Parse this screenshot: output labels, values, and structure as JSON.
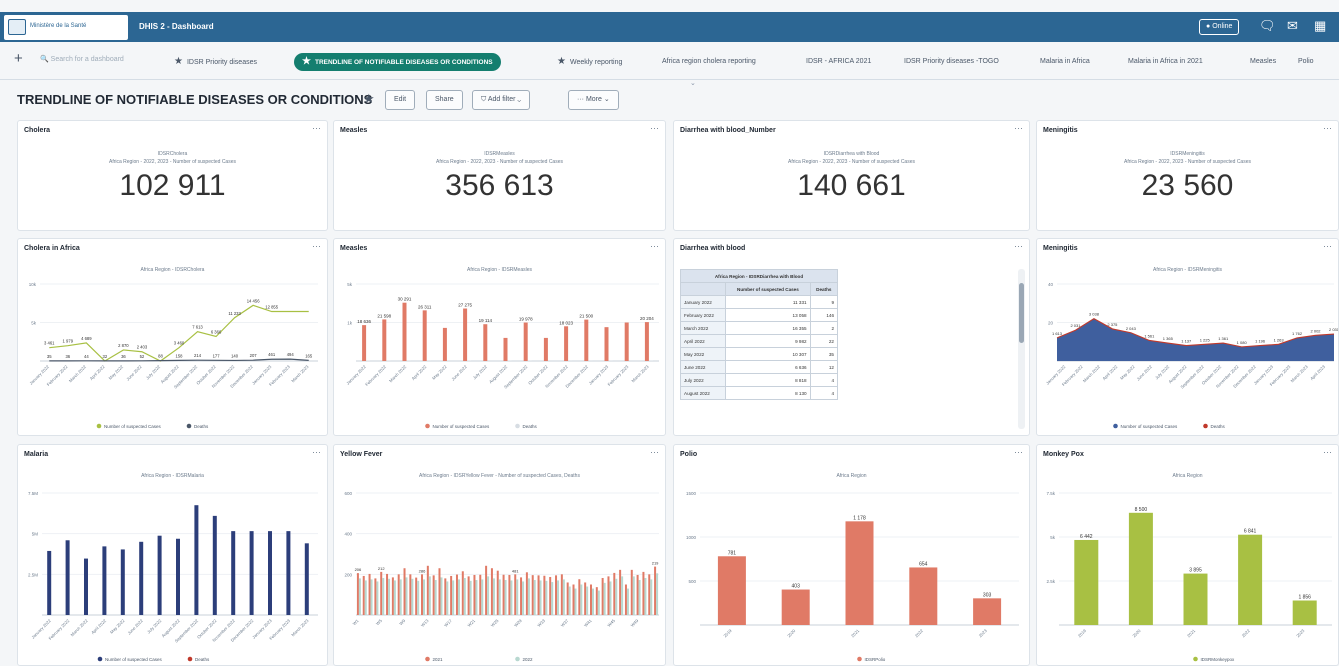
{
  "header": {
    "logo_text": "Ministère de la Santé",
    "app_title": "DHIS 2 - Dashboard",
    "online": "Online",
    "colors": {
      "bar": "#2c6693",
      "accent": "#147e6f"
    },
    "icons": [
      "chat-icon",
      "inbox-icon",
      "apps-icon"
    ]
  },
  "dashbar": {
    "add_icon": "+",
    "search_placeholder": "Search for a dashboard",
    "items": [
      {
        "label": "IDSR Priority diseases",
        "star": true
      },
      {
        "label": "TRENDLINE OF NOTIFIABLE DISEASES OR CONDITIONS",
        "star": true,
        "selected": true
      },
      {
        "label": "Weekly reporting",
        "star": true
      },
      {
        "label": "Africa region cholera reporting"
      },
      {
        "label": "IDSR - AFRICA 2021"
      },
      {
        "label": "IDSR Priority diseases -TOGO"
      },
      {
        "label": "Malaria in Africa"
      },
      {
        "label": "Malaria in Africa in 2021"
      },
      {
        "label": "Measles"
      },
      {
        "label": "Polio"
      }
    ]
  },
  "dashboard": {
    "title": "TRENDLINE OF NOTIFIABLE DISEASES OR CONDITIONS",
    "edit": "Edit",
    "share": "Share",
    "add_filter": "Add filter",
    "more": "More"
  },
  "cards": {
    "cholera_kpi": {
      "title": "Cholera",
      "sub1": "IDSRCholera",
      "sub2": "Africa Region - 2022, 2023 - Number of suspected Cases",
      "value": "102 911"
    },
    "measles_kpi": {
      "title": "Measles",
      "sub1": "IDSRMeasles",
      "sub2": "Africa Region - 2022, 2023 - Number of suspected Cases",
      "value": "356 613"
    },
    "diarrhea_kpi": {
      "title": "Diarrhea with blood_Number",
      "sub1": "IDSRDiarrhea with Blood",
      "sub2": "Africa Region - 2022, 2023 - Number of suspected Cases",
      "value": "140 661"
    },
    "meningitis_kpi": {
      "title": "Meningitis",
      "sub1": "IDSRMeningitis",
      "sub2": "Africa Region - 2022, 2023 - Number of suspected Cases",
      "value": "23 560"
    },
    "cholera_chart": {
      "title": "Cholera in Africa",
      "chart_title": "Africa Region - IDSRCholera"
    },
    "measles_chart": {
      "title": "Measles",
      "chart_title": "Africa Region - IDSRMeasles"
    },
    "diarrhea_table": {
      "title": "Diarrhea with blood",
      "header": "Africa Region - IDSRDiarrhea with Blood",
      "col1": "Number of suspected Cases",
      "col2": "Deaths",
      "rows": [
        {
          "period": "January 2022",
          "cases": "11 331",
          "deaths": "9"
        },
        {
          "period": "February 2022",
          "cases": "13 058",
          "deaths": "146"
        },
        {
          "period": "March 2022",
          "cases": "16 355",
          "deaths": "2"
        },
        {
          "period": "April 2022",
          "cases": "9 982",
          "deaths": "22"
        },
        {
          "period": "May 2022",
          "cases": "10 307",
          "deaths": "35"
        },
        {
          "period": "June 2022",
          "cases": "6 636",
          "deaths": "12"
        },
        {
          "period": "July 2022",
          "cases": "8 818",
          "deaths": "4"
        },
        {
          "period": "August 2022",
          "cases": "8 130",
          "deaths": "4"
        }
      ]
    },
    "meningitis_chart": {
      "title": "Meningitis",
      "chart_title": "Africa Region - IDSRMeningitis"
    },
    "malaria_chart": {
      "title": "Malaria",
      "chart_title": "Africa Region - IDSRMalaria"
    },
    "yellow_chart": {
      "title": "Yellow Fever",
      "chart_title": "Africa Region - IDSRYellow Fever - Number of suspected Cases, Deaths"
    },
    "polio_chart": {
      "title": "Polio",
      "chart_title": "Africa Region"
    },
    "monkeypox_chart": {
      "title": "Monkey Pox",
      "chart_title": "Africa Region"
    }
  },
  "chart_data": [
    {
      "id": "cholera",
      "type": "line",
      "ylim": [
        0,
        20000
      ],
      "yticks": [
        "10k",
        "5k"
      ],
      "categories": [
        "January 2022",
        "February 2022",
        "March 2022",
        "April 2022",
        "May 2022",
        "June 2022",
        "July 2022",
        "August 2022",
        "September 2022",
        "October 2022",
        "November 2022",
        "December 2022",
        "January 2023",
        "February 2023",
        "March 2023"
      ],
      "series": [
        {
          "name": "Number of suspected Cases",
          "color": "#a8c043",
          "values": [
            3461,
            3979,
            4689,
            1,
            2870,
            2403,
            1,
            3460,
            7613,
            6366,
            11233,
            14456,
            12855,
            12855,
            12855
          ],
          "labels": [
            "3 461",
            "1 979",
            "4 689",
            "",
            "2 870",
            "2 403",
            "",
            "3 460",
            "7 613",
            "6 366",
            "11 233",
            "14 456",
            "12 855",
            "",
            ""
          ]
        },
        {
          "name": "Deaths",
          "color": "#4a5768",
          "values": [
            35,
            36,
            44,
            32,
            36,
            52,
            88,
            158,
            214,
            177,
            140,
            207,
            461,
            494,
            165
          ],
          "labels": [
            "35",
            "36",
            "44",
            "32",
            "36",
            "52",
            "88",
            "158",
            "214",
            "177",
            "140",
            "207",
            "461",
            "494",
            "165"
          ]
        }
      ]
    },
    {
      "id": "measles",
      "type": "bar",
      "ylim": [
        0,
        40000
      ],
      "yticks": [
        "5k",
        "1k"
      ],
      "categories": [
        "January 2022",
        "February 2022",
        "March 2022",
        "April 2022",
        "May 2022",
        "June 2022",
        "July 2022",
        "August 2022",
        "September 2022",
        "October 2022",
        "November 2022",
        "December 2022",
        "January 2023",
        "February 2023",
        "March 2023"
      ],
      "series": [
        {
          "name": "Number of suspected Cases",
          "color": "#e07a66",
          "values": [
            18636,
            21598,
            30291,
            26311,
            17200,
            27275,
            19114,
            12001,
            19978,
            12001,
            18023,
            21500,
            17580,
            20000,
            20204
          ],
          "labels": [
            "18 636",
            "21 598",
            "30 291",
            "26 311",
            "",
            "27 275",
            "19 114",
            "",
            "19 978",
            "",
            "18 023",
            "21 500",
            "",
            "",
            "20 204"
          ]
        },
        {
          "name": "Deaths",
          "color": "#d7dde3",
          "values": [
            281,
            187,
            162,
            117,
            0,
            194,
            0,
            175,
            160,
            0,
            102,
            110,
            150,
            0,
            180
          ]
        }
      ]
    },
    {
      "id": "meningitis",
      "type": "area",
      "ylim": [
        0,
        60
      ],
      "categories": [
        "January 2022",
        "February 2022",
        "March 2022",
        "April 2022",
        "May 2022",
        "June 2022",
        "July 2022",
        "August 2022",
        "September 2022",
        "October 2022",
        "November 2022",
        "December 2022",
        "January 2023",
        "February 2023",
        "March 2023",
        "April 2023"
      ],
      "series": [
        {
          "name": "Number of suspected Cases",
          "color": "#3f5f9e",
          "values": [
            18,
            24,
            33,
            25,
            22,
            16,
            14,
            12,
            13,
            14,
            11,
            12,
            13,
            18,
            20,
            21
          ],
          "labels": [
            "1 613",
            "2 031",
            "3 038",
            "2 375",
            "2 043",
            "1 561",
            "1 365",
            "1 137",
            "1 225",
            "1 361",
            "1 080",
            "1 196",
            "1 263",
            "1 762",
            "2 002",
            "2 031"
          ]
        },
        {
          "name": "Deaths",
          "color": "#c0392b"
        }
      ]
    },
    {
      "id": "malaria",
      "type": "bar",
      "ylim": [
        0,
        8000000
      ],
      "yticks": [
        "7.5M",
        "5M",
        "2.5M"
      ],
      "categories": [
        "January 2022",
        "February 2022",
        "March 2022",
        "April 2022",
        "May 2022",
        "June 2022",
        "July 2022",
        "August 2022",
        "September 2022",
        "October 2022",
        "November 2022",
        "December 2022",
        "January 2023",
        "February 2023",
        "March 2023"
      ],
      "series": [
        {
          "name": "Number of suspected Cases",
          "color": "#2c3e7a",
          "values": [
            4200000,
            4900000,
            3700000,
            4500000,
            4300000,
            4800000,
            5200000,
            5000000,
            7200000,
            6500000,
            5500000,
            5500000,
            5500000,
            5500000,
            4700000
          ]
        },
        {
          "name": "Deaths",
          "color": "#c0392b"
        }
      ]
    },
    {
      "id": "yellow_fever",
      "type": "bar",
      "ylim": [
        0,
        600
      ],
      "yticks": [
        "600",
        "400",
        "200"
      ],
      "categories": [
        "W1",
        "W2",
        "W3",
        "W4",
        "W5",
        "W6",
        "W7",
        "W8",
        "W9",
        "W10",
        "W11",
        "W12",
        "W13",
        "W14",
        "W15",
        "W16",
        "W17",
        "W18",
        "W19",
        "W20",
        "W21",
        "W22",
        "W23",
        "W24",
        "W25",
        "W26",
        "W27",
        "W28",
        "W29",
        "W30",
        "W31",
        "W32",
        "W33",
        "W34",
        "W35",
        "W36",
        "W37",
        "W38",
        "W39",
        "W40",
        "W41",
        "W42",
        "W43",
        "W44",
        "W45",
        "W46",
        "W47",
        "W48",
        "W49",
        "W50",
        "W51",
        "W52"
      ],
      "series": [
        {
          "name": "2021",
          "color": "#e07a66",
          "values": [
            206,
            192,
            202,
            180,
            212,
            202,
            185,
            200,
            230,
            200,
            184,
            200,
            242,
            195,
            230,
            180,
            192,
            199,
            215,
            190,
            197,
            198,
            242,
            230,
            218,
            198,
            197,
            200,
            185,
            210,
            196,
            195,
            193,
            187,
            195,
            200,
            160,
            150,
            176,
            160,
            150,
            137,
            182,
            190,
            207,
            222,
            150,
            222,
            197,
            212,
            200,
            238
          ],
          "labels": [
            "206",
            "",
            "",
            "",
            "212",
            "",
            "",
            "",
            "",
            "",
            "",
            "286",
            "",
            "",
            "",
            "",
            "",
            "",
            "",
            "",
            "",
            "",
            "",
            "",
            "",
            "",
            "",
            "481",
            "",
            "",
            "",
            "",
            "",
            "",
            "",
            "",
            "",
            "",
            "",
            "",
            "",
            "",
            "",
            "",
            "",
            "",
            "",
            "",
            "",
            "",
            "",
            "219"
          ]
        },
        {
          "name": "2022",
          "color": "#b8d8d0",
          "values": [
            180,
            170,
            175,
            165,
            182,
            178,
            170,
            175,
            185,
            178,
            168,
            175,
            190,
            172,
            185,
            165,
            170,
            175,
            182,
            168,
            172,
            175,
            190,
            180,
            175,
            172,
            170,
            175,
            165,
            180,
            172,
            170,
            168,
            162,
            170,
            175,
            140,
            130,
            150,
            140,
            130,
            120,
            158,
            165,
            178,
            190,
            130,
            190,
            172,
            182,
            175,
            205
          ]
        }
      ]
    },
    {
      "id": "polio",
      "type": "bar",
      "ylim": [
        0,
        1500
      ],
      "yticks": [
        "1500",
        "1000",
        "500"
      ],
      "categories": [
        "2019",
        "2020",
        "2021",
        "2022",
        "2023"
      ],
      "series": [
        {
          "name": "IDSRPolio",
          "color": "#e07a66",
          "values": [
            781,
            403,
            1178,
            654,
            303
          ],
          "labels": [
            "781",
            "403",
            "1 178",
            "654",
            "303"
          ]
        }
      ]
    },
    {
      "id": "monkeypox",
      "type": "bar",
      "ylim": [
        0,
        10000
      ],
      "yticks": [
        "7.5k",
        "5k",
        "2.5k"
      ],
      "categories": [
        "2019",
        "2020",
        "2021",
        "2022",
        "2023"
      ],
      "series": [
        {
          "name": "IDSRMonkeypox",
          "color": "#a8c043",
          "values": [
            6442,
            8500,
            3895,
            6841,
            1856
          ],
          "labels": [
            "6 442",
            "8 500",
            "3 895",
            "6 841",
            "1 856"
          ]
        }
      ]
    }
  ]
}
